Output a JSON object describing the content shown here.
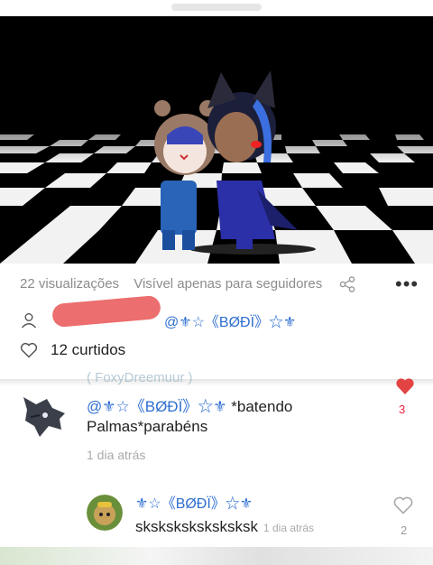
{
  "post": {
    "views": "22 visualizações",
    "visibility": "Visível apenas para seguidores",
    "mention": "@⚜☆《BØĐÏ》☆⚜",
    "likes": "12 curtidos"
  },
  "comments": [
    {
      "ghost_name": "( FoxyDreemuur )",
      "text": "@⚜☆《BØĐÏ》☆⚜ *batendo Palmas*parabéns",
      "mention": "@⚜☆《BØĐÏ》☆⚜",
      "body": "*batendo Palmas*parabéns",
      "time": "1 dia atrás",
      "likes": "3"
    }
  ],
  "reply": {
    "name": "⚜☆《BØĐÏ》☆⚜",
    "text": "sksksksksksksksk",
    "time": "1 dia atrás",
    "likes": "2"
  },
  "icons": {
    "share": "share-icon",
    "more": "more-options-icon",
    "user": "user-icon",
    "heart": "heart-icon"
  },
  "colors": {
    "accent_blue": "#2f6fd0",
    "like_red": "#e24444"
  }
}
